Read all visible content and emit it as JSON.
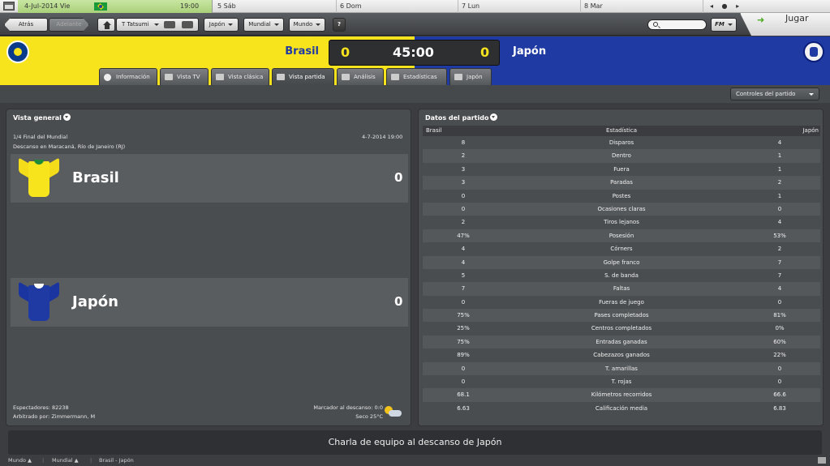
{
  "datebar": {
    "today_date": "4-Jul-2014 Vie",
    "today_time": "19:00",
    "days": [
      "5 Sáb",
      "6 Dom",
      "7 Lun",
      "8 Mar"
    ],
    "nav_controls": "◂ ● ▸"
  },
  "toolbar": {
    "back_label": "Atrás",
    "forward_label": "Adelante",
    "manager_label": "T Tatsumi",
    "team_menu": "Japón",
    "competition_menu": "Mundial",
    "world_menu": "Mundo",
    "help_label": "?",
    "fm_label": "FM",
    "play_label": "Jugar",
    "play_arrow": "➜"
  },
  "match": {
    "home_team": "Brasil",
    "away_team": "Japón",
    "home_score": "0",
    "away_score": "0",
    "clock": "45:00",
    "colors": {
      "home": "#f7e41d",
      "away": "#1f3aa3"
    }
  },
  "tabs": [
    {
      "label": "Información",
      "icon": "info-icon"
    },
    {
      "label": "Vista TV",
      "icon": "tv-icon"
    },
    {
      "label": "Vista clásica",
      "icon": "pitch-icon"
    },
    {
      "label": "Vista partida",
      "icon": "split-view-icon",
      "active": true
    },
    {
      "label": "Análisis",
      "icon": "analysis-icon"
    },
    {
      "label": "Estadísticas",
      "icon": "stats-icon"
    },
    {
      "label": "Japón",
      "icon": "team-icon"
    }
  ],
  "match_controls_label": "Controles del partido",
  "overview": {
    "title": "Vista general",
    "stage": "1/4 Final del Mundial",
    "date": "4-7-2014 19:00",
    "status": "Descanso en Maracaná, Río de Janeiro (RJ)",
    "home_name": "Brasil",
    "home_score": "0",
    "away_name": "Japón",
    "away_score": "0",
    "attendance": "Espectadores: 82238",
    "referee": "Arbitrado por: Zimmermann, M",
    "halftime": "Marcador al descanso: 0:0",
    "weather": "Seco 25°C"
  },
  "stats": {
    "title": "Datos del partido",
    "header": {
      "home": "Brasil",
      "stat": "Estadística",
      "away": "Japón"
    },
    "rows": [
      {
        "home": "8",
        "stat": "Disparos",
        "away": "4"
      },
      {
        "home": "2",
        "stat": "Dentro",
        "away": "1"
      },
      {
        "home": "3",
        "stat": "Fuera",
        "away": "1"
      },
      {
        "home": "3",
        "stat": "Paradas",
        "away": "2"
      },
      {
        "home": "0",
        "stat": "Postes",
        "away": "1"
      },
      {
        "home": "0",
        "stat": "Ocasiones claras",
        "away": "0"
      },
      {
        "home": "2",
        "stat": "Tiros lejanos",
        "away": "4"
      },
      {
        "home": "47%",
        "stat": "Posesión",
        "away": "53%"
      },
      {
        "home": "4",
        "stat": "Córners",
        "away": "2"
      },
      {
        "home": "4",
        "stat": "Golpe franco",
        "away": "7"
      },
      {
        "home": "5",
        "stat": "S. de banda",
        "away": "7"
      },
      {
        "home": "7",
        "stat": "Faltas",
        "away": "4"
      },
      {
        "home": "0",
        "stat": "Fueras de juego",
        "away": "0"
      },
      {
        "home": "75%",
        "stat": "Pases completados",
        "away": "81%"
      },
      {
        "home": "25%",
        "stat": "Centros completados",
        "away": "0%"
      },
      {
        "home": "75%",
        "stat": "Entradas ganadas",
        "away": "60%"
      },
      {
        "home": "89%",
        "stat": "Cabezazos ganados",
        "away": "22%"
      },
      {
        "home": "0",
        "stat": "T. amarillas",
        "away": "0"
      },
      {
        "home": "0",
        "stat": "T. rojas",
        "away": "0"
      },
      {
        "home": "68.1",
        "stat": "Kilómetros recorridos",
        "away": "66.6"
      },
      {
        "home": "6.63",
        "stat": "Calificación media",
        "away": "6.83"
      }
    ]
  },
  "team_talk": "Charla de equipo al descanso de Japón",
  "footer": {
    "world": "Mundo ▲",
    "competition": "Mundial ▲",
    "match": "Brasil - Japón"
  }
}
